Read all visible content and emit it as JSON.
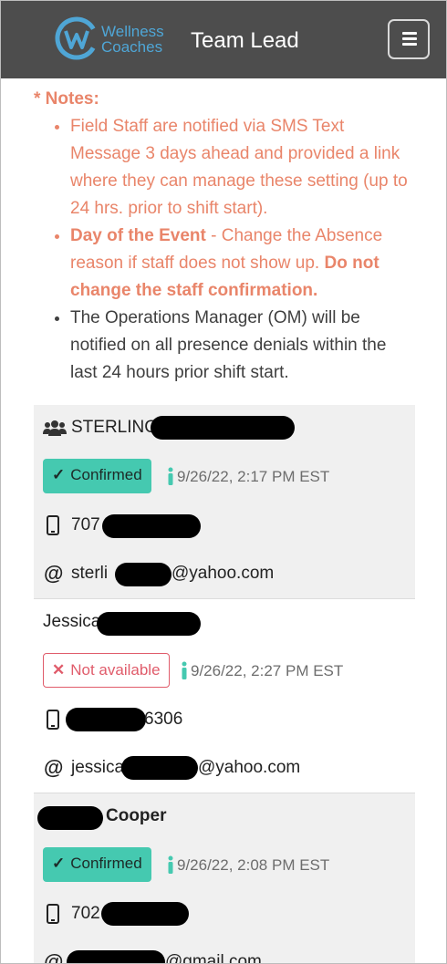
{
  "header": {
    "brand_line1": "Wellness",
    "brand_line2": "Coaches",
    "title": "Team Lead",
    "menu_icon": "hamburger-icon"
  },
  "colors": {
    "header_bg": "#4d4d4d",
    "brand_blue": "#4fa6d6",
    "note_orange": "#e9856a",
    "confirmed_green": "#45c9b0",
    "unavailable_red": "#e05c6b",
    "card_shade": "#f0f0f0"
  },
  "notes": {
    "title": "* Notes:",
    "item1": "Field Staff are notified via SMS Text Message 3 days ahead and provided a link where they can manage these setting (up to 24 hrs. prior to shift start).",
    "item2_bold": "Day of the Event",
    "item2_text": " - Change the Absence reason if staff does not show up. ",
    "item2_bold2": "Do not change the staff confirmation.",
    "item3": "The Operations Manager (OM) will be notified on all presence denials within the last 24 hours prior shift start."
  },
  "staff": [
    {
      "name": "STERLING",
      "status": "Confirmed",
      "timestamp": "9/26/22, 2:17 PM EST",
      "phone": "707",
      "email_prefix": "sterli",
      "email_suffix": "@yahoo.com"
    },
    {
      "name": "Jessica",
      "status": "Not available",
      "timestamp": "9/26/22, 2:27 PM EST",
      "phone": "6306",
      "email_prefix": "jessica",
      "email_suffix": "@yahoo.com"
    },
    {
      "name": "Cooper",
      "status": "Confirmed",
      "timestamp": "9/26/22, 2:08 PM EST",
      "phone": "702",
      "email_prefix": "",
      "email_suffix": "@gmail.com"
    }
  ]
}
